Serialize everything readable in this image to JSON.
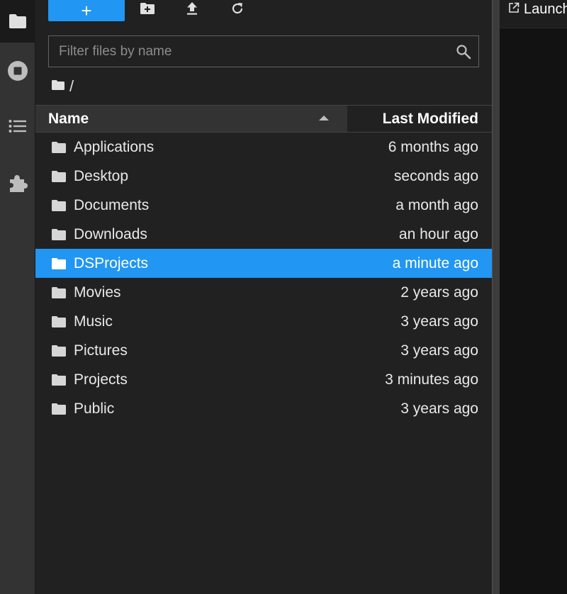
{
  "activity_bar": {
    "tabs": [
      {
        "icon": "folder-icon",
        "active": true
      },
      {
        "icon": "stop-circle-icon",
        "active": false
      },
      {
        "icon": "list-icon",
        "active": false
      },
      {
        "icon": "puzzle-icon",
        "active": false
      }
    ]
  },
  "toolbar": {
    "new_launcher_label": "+",
    "new_folder_icon": "new-folder-icon",
    "upload_icon": "upload-icon",
    "refresh_icon": "refresh-icon"
  },
  "filter": {
    "placeholder": "Filter files by name",
    "value": ""
  },
  "breadcrumbs": {
    "root_icon": "folder-icon",
    "separator": "/"
  },
  "list_header": {
    "name_label": "Name",
    "modified_label": "Last Modified",
    "sort_direction": "ascending"
  },
  "files": [
    {
      "name": "Applications",
      "modified": "6 months ago",
      "selected": false
    },
    {
      "name": "Desktop",
      "modified": "seconds ago",
      "selected": false
    },
    {
      "name": "Documents",
      "modified": "a month ago",
      "selected": false
    },
    {
      "name": "Downloads",
      "modified": "an hour ago",
      "selected": false
    },
    {
      "name": "DSProjects",
      "modified": "a minute ago",
      "selected": true
    },
    {
      "name": "Movies",
      "modified": "2 years ago",
      "selected": false
    },
    {
      "name": "Music",
      "modified": "3 years ago",
      "selected": false
    },
    {
      "name": "Pictures",
      "modified": "3 years ago",
      "selected": false
    },
    {
      "name": "Projects",
      "modified": "3 minutes ago",
      "selected": false
    },
    {
      "name": "Public",
      "modified": "3 years ago",
      "selected": false
    }
  ],
  "main_area": {
    "tab_label": "Launcher",
    "tab_icon": "launch-icon"
  },
  "colors": {
    "accent": "#2196f3",
    "panel_bg": "#212121",
    "sidebar_bg": "#333333",
    "text": "#e8e8e8"
  }
}
